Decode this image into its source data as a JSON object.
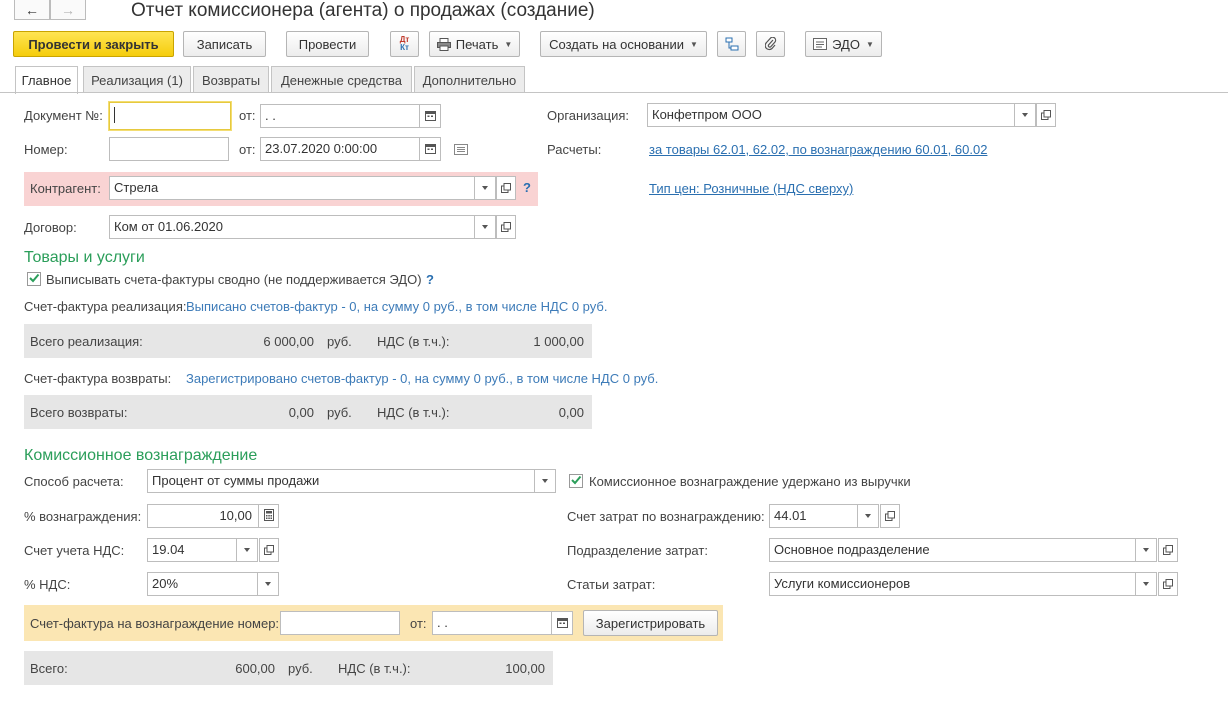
{
  "window": {
    "title": "Отчет комиссионера (агента) о продажах (создание)",
    "nav_back": "←",
    "nav_forward": "→"
  },
  "toolbar": {
    "post_and_close": "Провести и закрыть",
    "save": "Записать",
    "post": "Провести",
    "dt_kt_top": "Дт",
    "dt_kt_bottom": "Кт",
    "print": "Печать",
    "create_based_on": "Создать на основании",
    "edo": "ЭДО"
  },
  "tabs": [
    {
      "label": "Главное",
      "active": true
    },
    {
      "label": "Реализация (1)",
      "active": false
    },
    {
      "label": "Возвраты",
      "active": false
    },
    {
      "label": "Денежные средства",
      "active": false
    },
    {
      "label": "Дополнительно",
      "active": false
    }
  ],
  "header": {
    "doc_no_label": "Документ №:",
    "doc_no_value": "",
    "from_label": "от:",
    "doc_date": " .  .",
    "number_label": "Номер:",
    "number_value": "",
    "number_date": "23.07.2020  0:00:00",
    "org_label": "Организация:",
    "org_value": "Конфетпром ООО",
    "settlements_label": "Расчеты:",
    "settlements_link": "за товары 62.01, 62.02, по вознаграждению 60.01, 60.02",
    "counterparty_label": "Контрагент:",
    "counterparty_value": "Стрела",
    "price_type_link": "Тип цен: Розничные (НДС сверху)",
    "contract_label": "Договор:",
    "contract_value": "Ком от 01.06.2020",
    "help": "?"
  },
  "goods": {
    "section_title": "Товары и услуги",
    "consolidated_invoice_label": "Выписывать счета-фактуры сводно (не поддерживается ЭДО)",
    "consolidated_invoice_checked": true,
    "invoice_sales_label": "Счет-фактура реализация:",
    "invoice_sales_value": "Выписано счетов-фактур - 0, на сумму 0 руб., в том числе НДС 0 руб.",
    "total_sales_label": "Всего реализация:",
    "total_sales_value": "6 000,00",
    "currency": "руб.",
    "vat_label": "НДС (в т.ч.):",
    "sales_vat_value": "1 000,00",
    "invoice_returns_label": "Счет-фактура возвраты:",
    "invoice_returns_value": "Зарегистрировано счетов-фактур - 0, на сумму 0 руб., в том числе НДС 0 руб.",
    "total_returns_label": "Всего возвраты:",
    "total_returns_value": "0,00",
    "returns_vat_value": "0,00"
  },
  "commission": {
    "section_title": "Комиссионное вознаграждение",
    "calc_method_label": "Способ расчета:",
    "calc_method_value": "Процент от суммы продажи",
    "withheld_label": "Комиссионное вознаграждение удержано из выручки",
    "withheld_checked": true,
    "percent_label": "% вознаграждения:",
    "percent_value": "10,00",
    "cost_account_label": "Счет затрат по вознаграждению:",
    "cost_account_value": "44.01",
    "vat_account_label": "Счет учета НДС:",
    "vat_account_value": "19.04",
    "cost_division_label": "Подразделение затрат:",
    "cost_division_value": "Основное подразделение",
    "vat_percent_label": "% НДС:",
    "vat_percent_value": "20%",
    "cost_items_label": "Статьи затрат:",
    "cost_items_value": "Услуги комиссионеров",
    "invoice_number_label": "Счет-фактура на вознаграждение номер:",
    "invoice_number_value": "",
    "invoice_from_label": "от:",
    "invoice_date": " .  .",
    "register_button": "Зарегистрировать",
    "total_label": "Всего:",
    "total_value": "600,00",
    "total_currency": "руб.",
    "total_vat_label": "НДС (в т.ч.):",
    "total_vat_value": "100,00"
  },
  "colors": {
    "primary_button": "#f5cd0c",
    "section_header": "#2b9e5a",
    "link": "#2a6fb0",
    "required_highlight": "#f9d3d3",
    "invoice_highlight": "#fbe6b3",
    "summary_bar": "#e6e6e6"
  }
}
